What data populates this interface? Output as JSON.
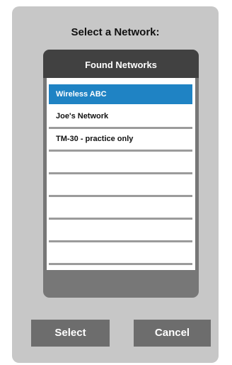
{
  "dialog": {
    "title": "Select a Network:"
  },
  "panel": {
    "header": "Found Networks",
    "networks": [
      {
        "label": "Wireless ABC",
        "selected": true
      },
      {
        "label": "Joe's Network",
        "selected": false
      },
      {
        "label": "TM-30 - practice only",
        "selected": false
      },
      {
        "label": "",
        "selected": false
      },
      {
        "label": "",
        "selected": false
      },
      {
        "label": "",
        "selected": false
      },
      {
        "label": "",
        "selected": false
      },
      {
        "label": "",
        "selected": false
      }
    ]
  },
  "buttons": {
    "select_label": "Select",
    "cancel_label": "Cancel"
  },
  "colors": {
    "selected_row": "#1f83c4",
    "header": "#414141",
    "buttons": "#6d6d6d"
  }
}
